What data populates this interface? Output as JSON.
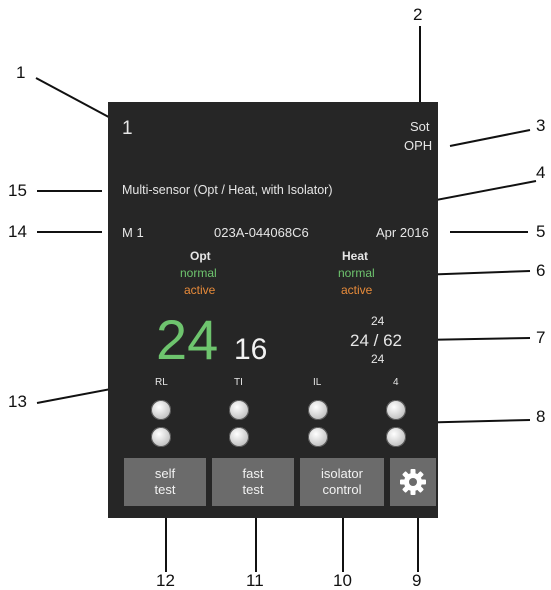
{
  "callouts": [
    "1",
    "2",
    "3",
    "4",
    "5",
    "6",
    "7",
    "8",
    "9",
    "10",
    "11",
    "12",
    "13",
    "14",
    "15"
  ],
  "device": {
    "address": "1",
    "type_short": "Sot",
    "type_code": "OPH",
    "description": "Multi-sensor (Opt / Heat, with Isolator)",
    "loop": "M 1",
    "serial": "023A-044068C6",
    "date": "Apr 2016"
  },
  "opt": {
    "label": "Opt",
    "state1": "normal",
    "state2": "active"
  },
  "heat": {
    "label": "Heat",
    "state1": "normal",
    "state2": "active"
  },
  "values": {
    "big": "24",
    "small": "16",
    "range_top": "24",
    "range_mid": "24 / 62",
    "range_bottom": "24"
  },
  "leds": {
    "labels": [
      "RL",
      "TI",
      "IL",
      "4"
    ]
  },
  "buttons": {
    "self_test": "self\ntest",
    "fast_test": "fast\ntest",
    "isolator_control": "isolator\ncontrol"
  },
  "icons": {
    "settings": "gear-icon"
  },
  "colors": {
    "panel": "#262626",
    "green": "#6ec46e",
    "orange": "#e88b3a",
    "button": "#6b6b6b"
  }
}
